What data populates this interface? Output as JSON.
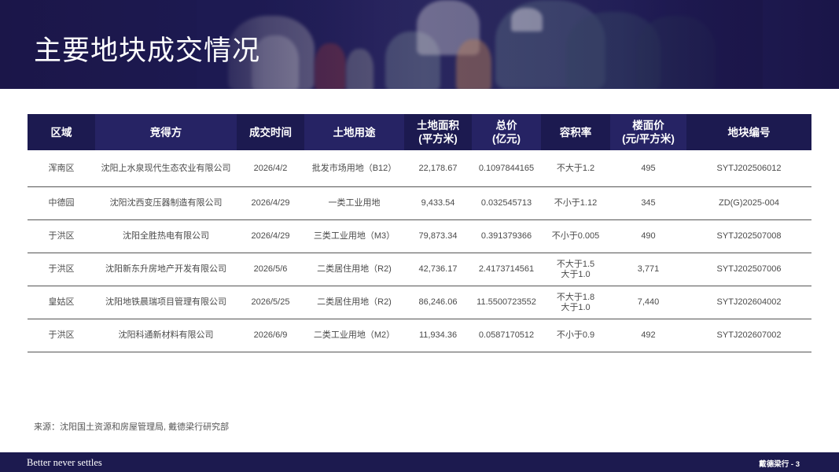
{
  "header": {
    "title": "主要地块成交情况"
  },
  "table": {
    "columns": [
      {
        "label": "区域"
      },
      {
        "label": "竞得方"
      },
      {
        "label": "成交时间"
      },
      {
        "label": "土地用途"
      },
      {
        "label": "土地面积\n(平方米)"
      },
      {
        "label": "总价\n(亿元)"
      },
      {
        "label": "容积率"
      },
      {
        "label": "楼面价\n(元/平方米)"
      },
      {
        "label": "地块编号"
      }
    ],
    "rows": [
      [
        "浑南区",
        "沈阳上水泉现代生态农业有限公司",
        "2026/4/2",
        "批发市场用地（B12）",
        "22,178.67",
        "0.1097844165",
        "不大于1.2",
        "495",
        "SYTJ202506012"
      ],
      [
        "中德园",
        "沈阳沈西变压器制造有限公司",
        "2026/4/29",
        "一类工业用地",
        "9,433.54",
        "0.032545713",
        "不小于1.12",
        "345",
        "ZD(G)2025-004"
      ],
      [
        "于洪区",
        "沈阳全胜热电有限公司",
        "2026/4/29",
        "三类工业用地（M3）",
        "79,873.34",
        "0.391379366",
        "不小于0.005",
        "490",
        "SYTJ202507008"
      ],
      [
        "于洪区",
        "沈阳新东升房地产开发有限公司",
        "2026/5/6",
        "二类居住用地（R2)",
        "42,736.17",
        "2.4173714561",
        "不大于1.5\n大于1.0",
        "3,771",
        "SYTJ202507006"
      ],
      [
        "皇姑区",
        "沈阳地铁晨瑞项目管理有限公司",
        "2026/5/25",
        "二类居住用地（R2)",
        "86,246.06",
        "11.5500723552",
        "不大于1.8\n大于1.0",
        "7,440",
        "SYTJ202604002"
      ],
      [
        "于洪区",
        "沈阳科通新材料有限公司",
        "2026/6/9",
        "二类工业用地（M2）",
        "11,934.36",
        "0.0587170512",
        "不小于0.9",
        "492",
        "SYTJ202607002"
      ]
    ]
  },
  "source_note": "来源：沈阳国土资源和房屋管理局, 戴德梁行研究部",
  "footer": {
    "slogan": "Better never settles",
    "page_label": "戴德梁行 - 3"
  },
  "colors": {
    "brand_navy": "#1c1a50",
    "header_alt": "#262364"
  }
}
